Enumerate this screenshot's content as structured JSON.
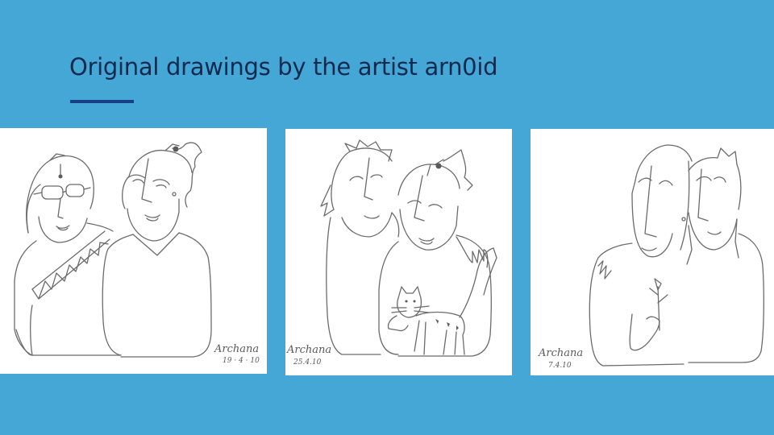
{
  "slide": {
    "title": "Original drawings by the artist arn0id",
    "colors": {
      "background": "#45a7d6",
      "title": "#10294e",
      "accent": "#163f86"
    }
  },
  "drawings": [
    {
      "signature": "Archana",
      "date": "19 · 4 · 10"
    },
    {
      "signature": "Archana",
      "date": "25.4.10"
    },
    {
      "signature": "Archana",
      "date": "7.4.10"
    }
  ]
}
